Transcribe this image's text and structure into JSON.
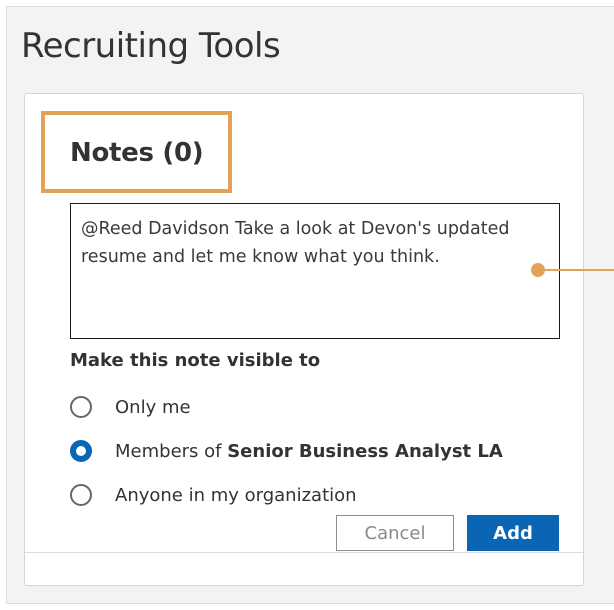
{
  "panel": {
    "title": "Recruiting Tools"
  },
  "notes": {
    "heading": "Notes (0)",
    "textarea_value": "@Reed Davidson Take a look at Devon's updated resume and let me know what you think."
  },
  "visibility": {
    "label": "Make this note visible to",
    "options": [
      {
        "label": "Only me",
        "checked": false
      },
      {
        "label_prefix": "Members of ",
        "label_strong": "Senior Business Analyst LA",
        "checked": true
      },
      {
        "label": "Anyone in my organization",
        "checked": false
      }
    ]
  },
  "actions": {
    "cancel_label": "Cancel",
    "add_label": "Add"
  },
  "colors": {
    "accent": "#0a66b5",
    "highlight": "#e2a257"
  }
}
